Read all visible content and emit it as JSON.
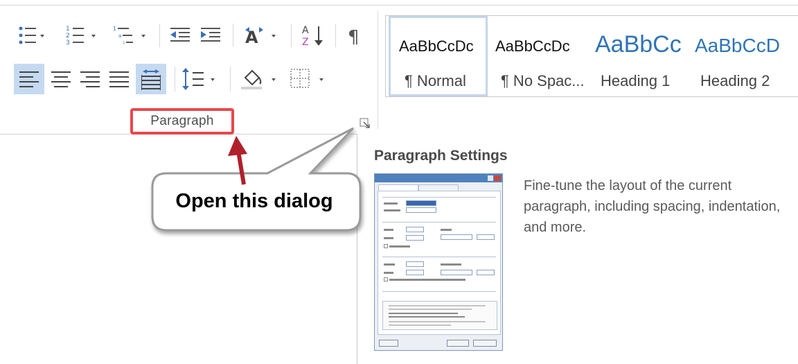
{
  "ribbon": {
    "paragraph_group": {
      "label": "Paragraph",
      "buttons_row1": [
        "bullets",
        "numbering",
        "multilevel-list",
        "decrease-indent",
        "increase-indent",
        "sort-spacing",
        "sort",
        "show-hide"
      ],
      "buttons_row2": [
        "align-left",
        "center",
        "align-right",
        "justify",
        "distributed",
        "line-spacing",
        "shading",
        "borders"
      ],
      "selected_alignment": "align-left"
    },
    "styles": [
      {
        "sample": "AaBbCcDc",
        "name": "¶ Normal",
        "selected": true
      },
      {
        "sample": "AaBbCcDc",
        "name": "¶ No Spac..."
      },
      {
        "sample": "AaBbCc",
        "name": "Heading 1"
      },
      {
        "sample": "AaBbCcD",
        "name": "Heading 2"
      }
    ]
  },
  "tooltip": {
    "title": "Paragraph Settings",
    "description": "Fine-tune the layout of the current paragraph, including spacing, indentation, and more."
  },
  "callout": {
    "text": "Open this dialog"
  },
  "colors": {
    "highlight_box": "#e8484a",
    "arrow": "#b0202a",
    "heading_blue": "#2e74b5",
    "active_button": "#c5d9f1"
  }
}
